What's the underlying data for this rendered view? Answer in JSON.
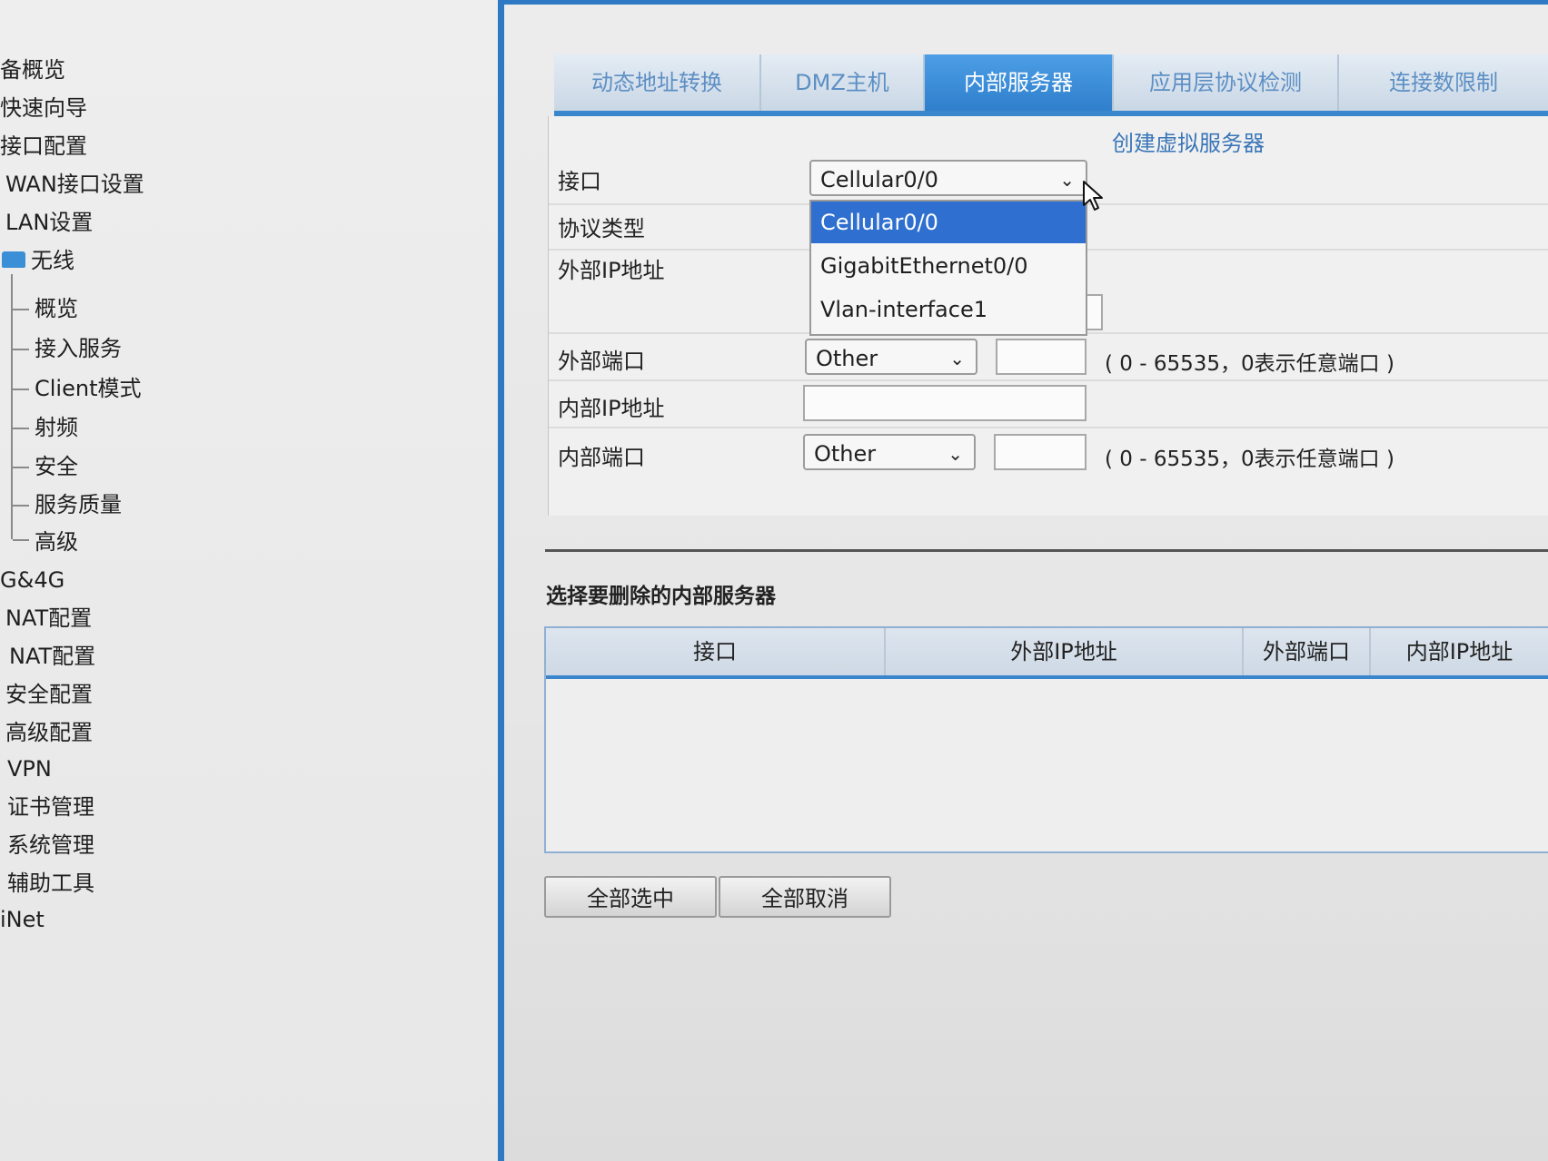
{
  "sidebar": {
    "items": [
      {
        "label": "备概览"
      },
      {
        "label": "快速向导"
      },
      {
        "label": "接口配置"
      },
      {
        "label": "WAN接口设置"
      },
      {
        "label": "LAN设置"
      },
      {
        "label": "无线"
      },
      {
        "label": "概览"
      },
      {
        "label": "接入服务"
      },
      {
        "label": "Client模式"
      },
      {
        "label": "射频"
      },
      {
        "label": "安全"
      },
      {
        "label": "服务质量"
      },
      {
        "label": "高级"
      },
      {
        "label": "G&4G"
      },
      {
        "label": "NAT配置"
      },
      {
        "label": "NAT配置"
      },
      {
        "label": "安全配置"
      },
      {
        "label": "高级配置"
      },
      {
        "label": "VPN"
      },
      {
        "label": "证书管理"
      },
      {
        "label": "系统管理"
      },
      {
        "label": "辅助工具"
      },
      {
        "label": "iNet"
      }
    ]
  },
  "tabs": [
    {
      "label": "动态地址转换"
    },
    {
      "label": "DMZ主机"
    },
    {
      "label": "内部服务器"
    },
    {
      "label": "应用层协议检测"
    },
    {
      "label": "连接数限制"
    }
  ],
  "form": {
    "title": "创建虚拟服务器",
    "interface_label": "接口",
    "interface_value": "Cellular0/0",
    "protocol_label": "协议类型",
    "external_ip_label": "外部IP地址",
    "external_port_label": "外部端口",
    "external_port_select": "Other",
    "external_port_hint": "( 0 - 65535，0表示任意端口 )",
    "internal_ip_label": "内部IP地址",
    "internal_port_label": "内部端口",
    "internal_port_select": "Other",
    "internal_port_hint": "( 0 - 65535，0表示任意端口 )"
  },
  "dropdown": {
    "options": [
      "Cellular0/0",
      "GigabitEthernet0/0",
      "Vlan-interface1"
    ],
    "selected": "Cellular0/0"
  },
  "delete_section": {
    "title": "选择要删除的内部服务器",
    "columns": [
      "接口",
      "外部IP地址",
      "外部端口",
      "内部IP地址"
    ],
    "rows": []
  },
  "buttons": {
    "select_all": "全部选中",
    "deselect_all": "全部取消"
  },
  "colors": {
    "accent": "#2f78c4",
    "selected_option": "#2f6fd0"
  }
}
